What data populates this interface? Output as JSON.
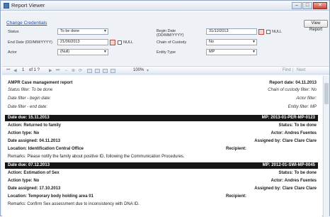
{
  "window": {
    "title": "Report Viewer",
    "minimize": "–",
    "maximize": "□",
    "close": "✕"
  },
  "filters": {
    "change_credentials": "Change Credentials",
    "view_report": "View Report",
    "status_label": "Status",
    "status_value": "To be done",
    "end_date_label": "End Date (DD/MM/YYYY)",
    "end_date_value": "21/06/2013",
    "actor_label": "Actor",
    "actor_value": "(Null)",
    "begin_date_label": "Begin Date",
    "begin_date_sub": "(DD/MM/YYYY)",
    "begin_date_value": "31/12/2013",
    "chain_label": "Chain of Custody",
    "chain_value": "No",
    "entity_label": "Entity Type",
    "entity_value": "MP",
    "null_label": "NULL"
  },
  "toolbar": {
    "page": "1",
    "of_pages": "of 1 ?",
    "zoom": "100%",
    "find": "Find",
    "next": "Next"
  },
  "report": {
    "title": "AMPR Case management report",
    "report_date": "Report date: 04.11.2013",
    "status_filter": "Status filter: To be done",
    "chain_filter": "Chain of custody filter: No",
    "begin_filter": "Date filter - begin date:",
    "actor_filter": "Actor filter:",
    "end_filter": "Date filter - end date:",
    "entity_filter": "Entity filter: MP",
    "records": [
      {
        "date_due": "Date due: 15.11.2013",
        "id": "MP: 2013-01-PER-MP-0123",
        "action": "Action: Returned to family",
        "status": "Status: To be done",
        "action_type": "Action type: No",
        "actor": "Actor: Andres Fuentes",
        "date_assigned": "Date assigned: 04.11.2013",
        "assigned_by": "Assigned by: Clare Clare Clare",
        "location": "Location: Identification Central Office",
        "recipient": "Recipient:",
        "remarks": "Remarks: Please notify the family about positive ID, following the Communication Procedures."
      },
      {
        "date_due": "Date due: 07.12.2013",
        "id": "MP: 2012-01-SWI-MP-0045",
        "action": "Action: Estimation of Sex",
        "status": "Status: To be done",
        "action_type": "Action type: No",
        "actor": "Actor: Andres Fuentes",
        "date_assigned": "Date assigned: 17.10.2013",
        "assigned_by": "Assigned by: Clare Clare Clare",
        "location": "Location: Temporary body holding area 01",
        "recipient": "Recipient:",
        "remarks": "Remarks: Confirm Sex assessment due to inconsistency with DNA ID."
      }
    ]
  }
}
